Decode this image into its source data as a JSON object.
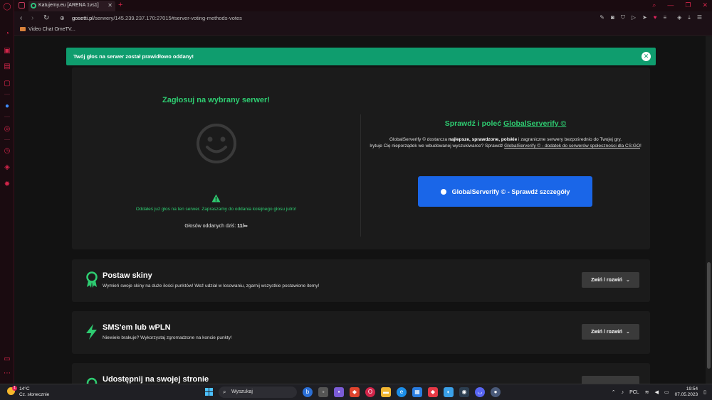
{
  "browser": {
    "tab_title": "Katujemy.eu [ARENA 1vs1]",
    "url_host": "gosetti.pl",
    "url_path": "/serwery/145.239.237.170:27015#server-voting-methods-votes",
    "bookmark": "Video Chat OmeTV..."
  },
  "alert": {
    "text": "Twój głos na serwer został prawidłowo oddany!"
  },
  "vote": {
    "title": "Zagłosuj na wybrany serwer!",
    "already_voted": "Oddałeś już głos na ten serwer. Zapraszamy do oddania kolejnego głosu jutro!",
    "votes_today_label": "Głosów oddanych dziś:",
    "votes_today_value": "11/∞"
  },
  "global_serverify": {
    "title_prefix": "Sprawdź i poleć",
    "title_link": "GlobalServerify ©",
    "desc_1": "GlobalServerify © dostarcza",
    "desc_bold_1": "najlepsze, sprawdzone, polskie",
    "desc_2": "i zagraniczne serwery bezpośrednio do Twojej gry.",
    "desc_3": "Irytuje Cię nieporządek we wbudowanej wyszukiwarce? Sprawdź",
    "desc_link": "GlobalServerify © - dodatek do serwerów społeczności dla CS:GO",
    "desc_end": "!",
    "button_label": "GlobalServerify © - Sprawdź szczegóły"
  },
  "sections": [
    {
      "title": "Postaw skiny",
      "desc": "Wymień swoje skiny na duże ilości punktów! Weź udział w losowaniu, zgarnij wszystkie postawione itemy!",
      "toggle": "Zwiń / rozwiń"
    },
    {
      "title": "SMS'em lub wPLN",
      "desc": "Niewiele brakuje? Wykorzystaj zgromadzone na koncie punkty!",
      "toggle": "Zwiń / rozwiń"
    },
    {
      "title": "Udostępnij na swojej stronie",
      "desc": "",
      "toggle": ""
    }
  ],
  "taskbar": {
    "weather_temp": "14°C",
    "weather_desc": "Cz. słonecznie",
    "weather_badge": "1",
    "search_placeholder": "Wyszukaj",
    "language": "PCL",
    "time": "19:54",
    "date": "07.05.2023"
  },
  "colors": {
    "accent_green": "#2ecc71",
    "alert_green": "#0f9d6e",
    "button_blue": "#1a66e8",
    "opera_red": "#d2254a"
  }
}
